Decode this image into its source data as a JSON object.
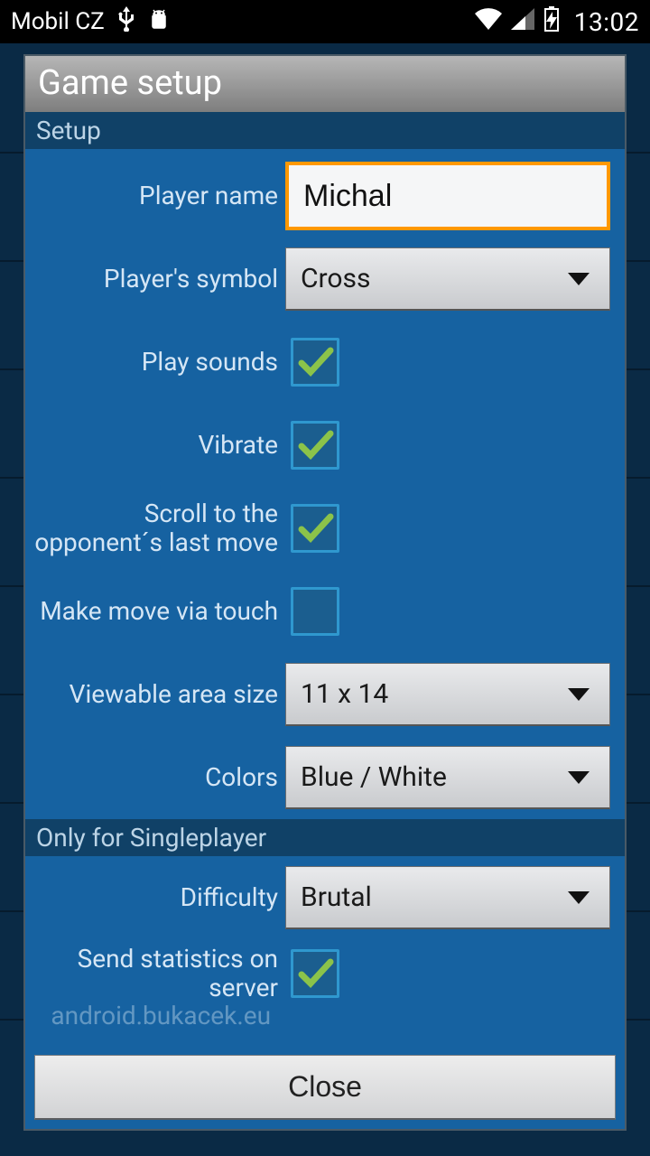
{
  "status_bar": {
    "carrier": "Mobil CZ",
    "time": "13:02"
  },
  "dialog": {
    "title": "Game setup",
    "sections": {
      "setup": "Setup",
      "singleplayer": "Only for Singleplayer"
    },
    "fields": {
      "player_name": {
        "label": "Player name",
        "value": "Michal"
      },
      "player_symbol": {
        "label": "Player's symbol",
        "value": "Cross"
      },
      "play_sounds": {
        "label": "Play sounds",
        "checked": true
      },
      "vibrate": {
        "label": "Vibrate",
        "checked": true
      },
      "scroll_opponent": {
        "label": "Scroll to the opponent´s last move",
        "checked": true
      },
      "make_move_touch": {
        "label": "Make move via touch",
        "checked": false
      },
      "viewable_area": {
        "label": "Viewable area size",
        "value": "11 x 14"
      },
      "colors": {
        "label": "Colors",
        "value": "Blue / White"
      },
      "difficulty": {
        "label": "Difficulty",
        "value": "Brutal"
      },
      "send_stats": {
        "label": "Send statistics on server",
        "checked": true,
        "sublabel": "android.bukacek.eu"
      }
    },
    "close_button": "Close"
  }
}
